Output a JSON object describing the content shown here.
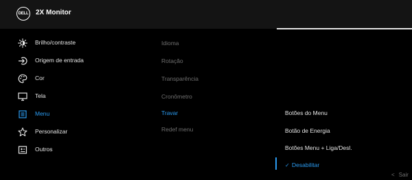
{
  "header": {
    "brand": "DELL",
    "title": "2X Monitor"
  },
  "menu": {
    "items": [
      {
        "label": "Brilho/contraste",
        "icon": "brightness-icon"
      },
      {
        "label": "Origem de entrada",
        "icon": "input-source-icon"
      },
      {
        "label": "Cor",
        "icon": "color-palette-icon"
      },
      {
        "label": "Tela",
        "icon": "display-icon"
      },
      {
        "label": "Menu",
        "icon": "menu-icon",
        "active": true
      },
      {
        "label": "Personalizar",
        "icon": "star-icon"
      },
      {
        "label": "Outros",
        "icon": "others-icon"
      }
    ]
  },
  "submenu": {
    "items": [
      {
        "label": "Idioma"
      },
      {
        "label": "Rotação"
      },
      {
        "label": "Transparência"
      },
      {
        "label": "Cronômetro"
      },
      {
        "label": "Travar",
        "active": true
      },
      {
        "label": "Redef menu"
      }
    ]
  },
  "options": {
    "items": [
      {
        "label": "Botões do Menu"
      },
      {
        "label": "Botão de Energia"
      },
      {
        "label": "Botões Menu + Liga/Desl."
      },
      {
        "label": "Desabilitar",
        "selected": true
      }
    ]
  },
  "footer": {
    "exit_label": "Sair",
    "exit_icon": "chevron-left-icon"
  },
  "colors": {
    "background": "#000000",
    "header": "#141414",
    "accent": "#2b9cf2",
    "text": "#e6e6e6",
    "muted": "#6f6f6f"
  }
}
